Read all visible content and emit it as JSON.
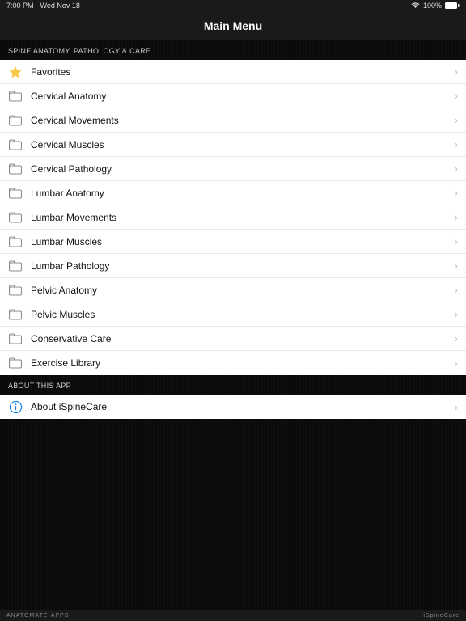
{
  "status": {
    "time": "7:00 PM",
    "date": "Wed Nov 18",
    "battery": "100%"
  },
  "nav": {
    "title": "Main Menu"
  },
  "sections": [
    {
      "header": "SPINE ANATOMY, PATHOLOGY & CARE",
      "items": [
        {
          "icon": "star",
          "label": "Favorites"
        },
        {
          "icon": "folder",
          "label": "Cervical Anatomy"
        },
        {
          "icon": "folder",
          "label": "Cervical Movements"
        },
        {
          "icon": "folder",
          "label": "Cervical Muscles"
        },
        {
          "icon": "folder",
          "label": "Cervical Pathology"
        },
        {
          "icon": "folder",
          "label": "Lumbar Anatomy"
        },
        {
          "icon": "folder",
          "label": "Lumbar Movements"
        },
        {
          "icon": "folder",
          "label": "Lumbar Muscles"
        },
        {
          "icon": "folder",
          "label": "Lumbar Pathology"
        },
        {
          "icon": "folder",
          "label": "Pelvic Anatomy"
        },
        {
          "icon": "folder",
          "label": "Pelvic Muscles"
        },
        {
          "icon": "folder",
          "label": "Conservative Care"
        },
        {
          "icon": "folder",
          "label": "Exercise Library"
        }
      ]
    },
    {
      "header": "ABOUT THIS APP",
      "items": [
        {
          "icon": "info",
          "label": "About iSpineCare"
        }
      ]
    }
  ],
  "footer": {
    "left": "ANATOMATE-APPS",
    "right": "iSpineCare"
  }
}
